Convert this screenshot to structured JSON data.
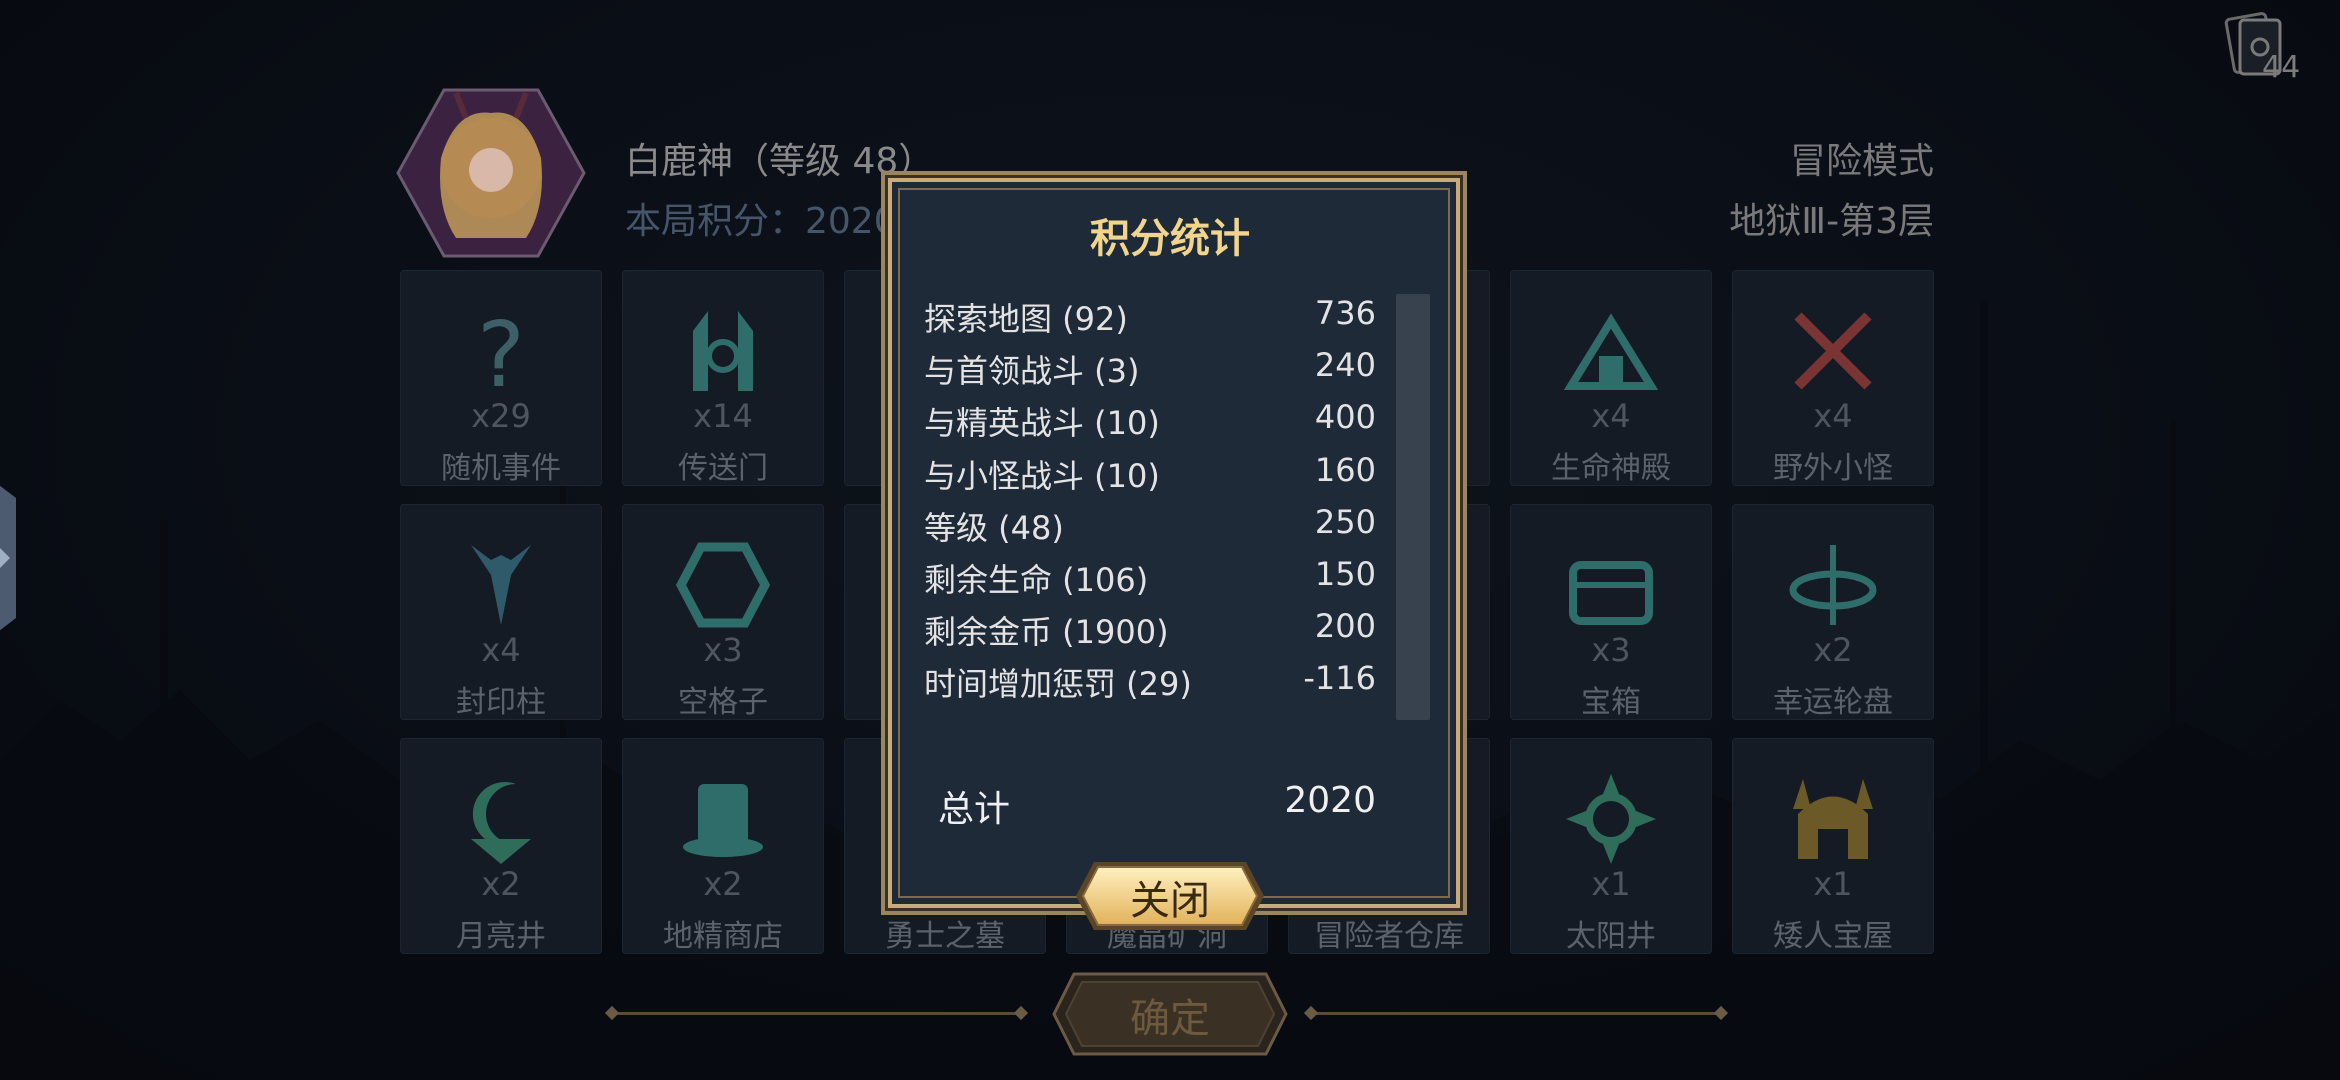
{
  "deck": {
    "count": "44",
    "icon": "card-deck-icon"
  },
  "header": {
    "hero_name": "白鹿神（等级 48）",
    "score_line": "本局积分：2020",
    "mode": "冒险模式",
    "level": "地狱Ⅲ-第3层"
  },
  "tiles": [
    {
      "icon": "question-mark-icon",
      "count": "x29",
      "name": "随机事件"
    },
    {
      "icon": "portal-icon",
      "count": "x14",
      "name": "传送门"
    },
    {
      "icon": "",
      "count": "",
      "name": ""
    },
    {
      "icon": "",
      "count": "",
      "name": ""
    },
    {
      "icon": "",
      "count": "",
      "name": ""
    },
    {
      "icon": "temple-icon",
      "count": "x4",
      "name": "生命神殿"
    },
    {
      "icon": "crossed-swords-icon",
      "count": "x4",
      "name": "野外小怪"
    },
    {
      "icon": "seal-pillar-icon",
      "count": "x4",
      "name": "封印柱"
    },
    {
      "icon": "hexagon-icon",
      "count": "x3",
      "name": "空格子"
    },
    {
      "icon": "",
      "count": "",
      "name": ""
    },
    {
      "icon": "",
      "count": "",
      "name": ""
    },
    {
      "icon": "",
      "count": "",
      "name": ""
    },
    {
      "icon": "treasure-chest-icon",
      "count": "x3",
      "name": "宝箱"
    },
    {
      "icon": "wheel-icon",
      "count": "x2",
      "name": "幸运轮盘"
    },
    {
      "icon": "moon-well-icon",
      "count": "x2",
      "name": "月亮井"
    },
    {
      "icon": "gnome-shop-icon",
      "count": "x2",
      "name": "地精商店"
    },
    {
      "icon": "",
      "count": "",
      "name": "勇士之墓"
    },
    {
      "icon": "",
      "count": "",
      "name": "魔晶矿洞"
    },
    {
      "icon": "",
      "count": "",
      "name": "冒险者仓库"
    },
    {
      "icon": "sun-well-icon",
      "count": "x1",
      "name": "太阳井"
    },
    {
      "icon": "dwarf-helmet-icon",
      "count": "x1",
      "name": "矮人宝屋"
    }
  ],
  "modal": {
    "title": "积分统计",
    "rows": [
      {
        "label": "探索地图 (92)",
        "value": "736"
      },
      {
        "label": "与首领战斗 (3)",
        "value": "240"
      },
      {
        "label": "与精英战斗 (10)",
        "value": "400"
      },
      {
        "label": "与小怪战斗 (10)",
        "value": "160"
      },
      {
        "label": "等级 (48)",
        "value": "250"
      },
      {
        "label": "剩余生命 (106)",
        "value": "150"
      },
      {
        "label": "剩余金币 (1900)",
        "value": "200"
      },
      {
        "label": "时间增加惩罚 (29)",
        "value": "-116"
      }
    ],
    "total_label": "总计",
    "total_value": "2020",
    "close_label": "关闭"
  },
  "confirm_label": "确定",
  "colors": {
    "gold": "#f2d58c",
    "panel": "#1f2a38",
    "border": "#c8ac7a"
  }
}
